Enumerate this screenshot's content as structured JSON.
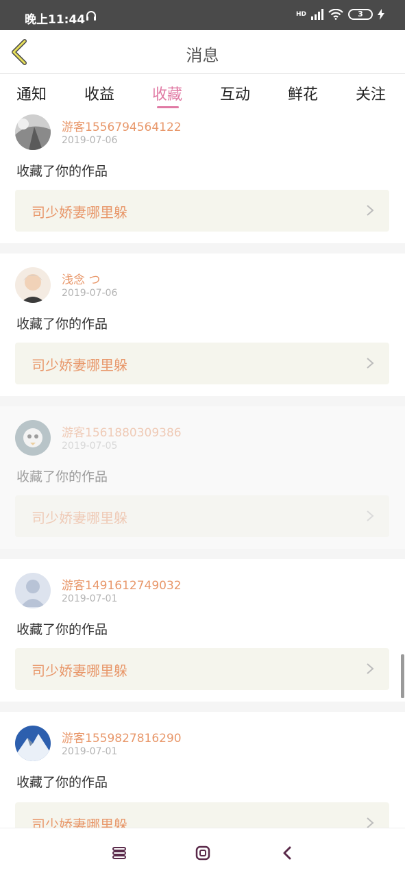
{
  "status_bar": {
    "time": "晚上11:44",
    "battery": "3",
    "network": "HD"
  },
  "header": {
    "title": "消息"
  },
  "tabs": [
    {
      "label": "通知",
      "active": false
    },
    {
      "label": "收益",
      "active": false
    },
    {
      "label": "收藏",
      "active": true
    },
    {
      "label": "互动",
      "active": false
    },
    {
      "label": "鲜花",
      "active": false
    },
    {
      "label": "关注",
      "active": false
    }
  ],
  "messages": [
    {
      "username": "游客1556794564122",
      "date": "2019-07-06",
      "action": "收藏了你的作品",
      "work_title": "司少娇妻哪里躲"
    },
    {
      "username": "浅念 つ",
      "date": "2019-07-06",
      "action": "收藏了你的作品",
      "work_title": "司少娇妻哪里躲"
    },
    {
      "username": "游客1561880309386",
      "date": "2019-07-05",
      "action": "收藏了你的作品",
      "work_title": "司少娇妻哪里躲"
    },
    {
      "username": "游客1491612749032",
      "date": "2019-07-01",
      "action": "收藏了你的作品",
      "work_title": "司少娇妻哪里躲"
    },
    {
      "username": "游客1559827816290",
      "date": "2019-07-01",
      "action": "收藏了你的作品",
      "work_title": "司少娇妻哪里躲"
    }
  ],
  "colors": {
    "accent": "#e07aa4",
    "username": "#e8976a",
    "work_box": "#f5f5ed",
    "status_bar": "#4a4a4a"
  }
}
